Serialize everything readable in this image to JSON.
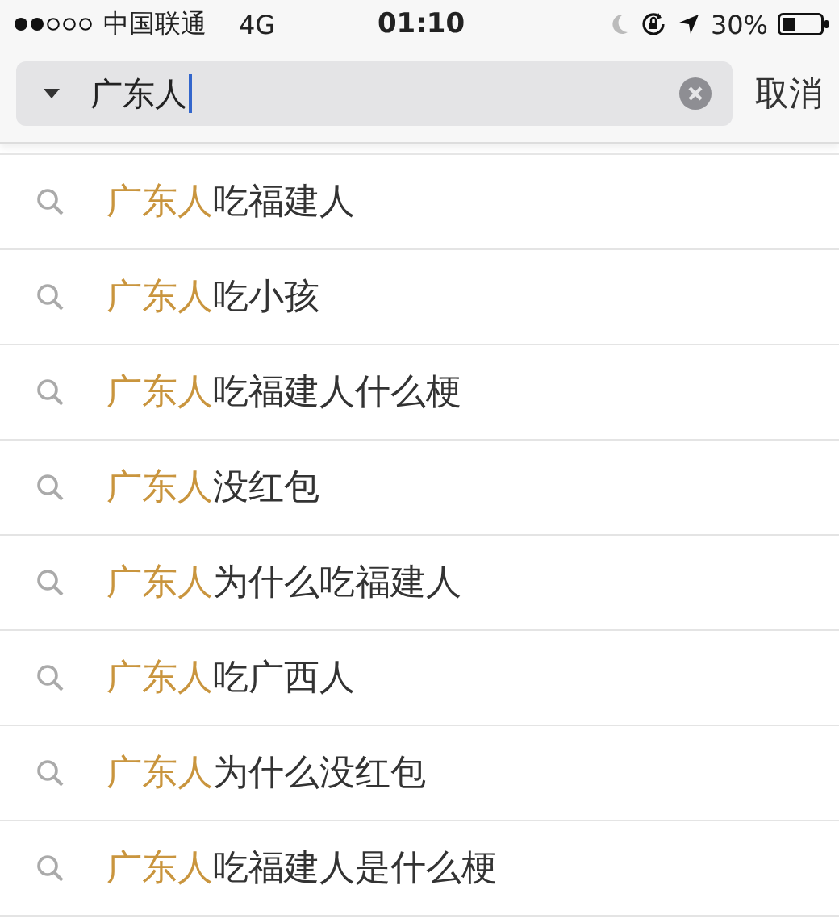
{
  "status_bar": {
    "carrier": "中国联通",
    "network": "4G",
    "time": "01:10",
    "battery": "30%"
  },
  "search": {
    "value": "广东人",
    "cancel": "取消"
  },
  "suggestions": [
    {
      "match": "广东人",
      "rest": "吃福建人"
    },
    {
      "match": "广东人",
      "rest": "吃小孩"
    },
    {
      "match": "广东人",
      "rest": "吃福建人什么梗"
    },
    {
      "match": "广东人",
      "rest": "没红包"
    },
    {
      "match": "广东人",
      "rest": "为什么吃福建人"
    },
    {
      "match": "广东人",
      "rest": "吃广西人"
    },
    {
      "match": "广东人",
      "rest": "为什么没红包"
    },
    {
      "match": "广东人",
      "rest": "吃福建人是什么梗"
    }
  ]
}
